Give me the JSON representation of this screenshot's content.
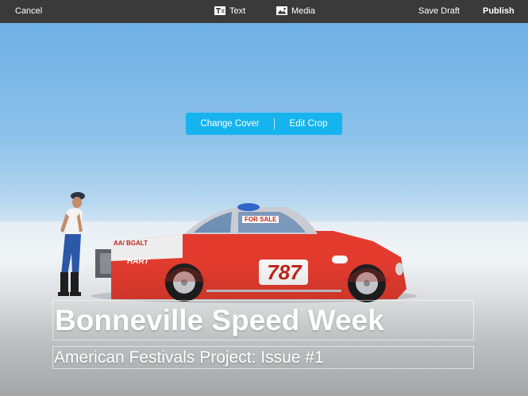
{
  "toolbar": {
    "cancel_label": "Cancel",
    "text_label": "Text",
    "media_label": "Media",
    "save_draft_label": "Save Draft",
    "publish_label": "Publish",
    "background_color": "#3a3a3a",
    "text_icon": "text-block-icon",
    "media_icon": "image-icon"
  },
  "cover": {
    "change_cover_label": "Change Cover",
    "edit_crop_label": "Edit Crop",
    "button_color": "#16b4ee"
  },
  "story": {
    "title": "Bonneville Speed Week",
    "subtitle": "American Festivals Project: Issue #1"
  },
  "photo": {
    "car_number": "787",
    "door_sign": "FOR SALE",
    "left_sign": "AA/ BGALT",
    "brand_text": "HART",
    "car_color": "#e23b2e"
  }
}
